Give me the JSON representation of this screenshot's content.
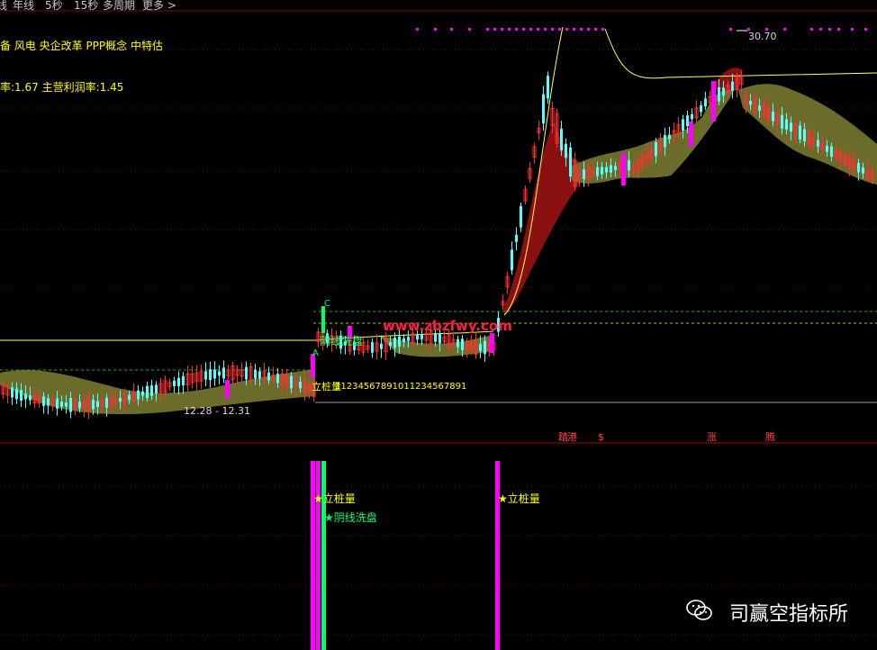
{
  "toolbar": {
    "items": [
      "线",
      "年线",
      "5秒",
      "15秒",
      "多周期",
      "更多 >"
    ]
  },
  "info": {
    "concepts": "备 风电 央企改革 PPP概念 中特估",
    "ratios": "率:1.67 主营利润率:1.45"
  },
  "chart_data": {
    "type": "candlestick",
    "annotations": {
      "peak_price": "30.70",
      "date_range": "12.28 - 12.31",
      "marker_a": "A",
      "marker_c": "C",
      "label_yinxian": "阴线洗盘",
      "label_lizhuang": "立桩量",
      "counter_text": "11234567891011234567891",
      "watermark_url": "www.zbzfwy.com",
      "event_1": "踏",
      "event_2": "港",
      "event_3": "$",
      "event_4": "涨",
      "event_5": "腾"
    },
    "lower_panel": {
      "label_1": "★立桩量",
      "label_2": "★阴线洗盘",
      "label_3": "★立桩量"
    }
  },
  "watermark": {
    "brand": "司赢空指标所"
  },
  "colors": {
    "up": "#ff3030",
    "down": "#54ffff",
    "magenta": "#ff00ff",
    "yellow": "#ffff00",
    "cloud": "#6b6b2a",
    "cloud_red": "#8b1010",
    "grid": "#8b0000"
  }
}
